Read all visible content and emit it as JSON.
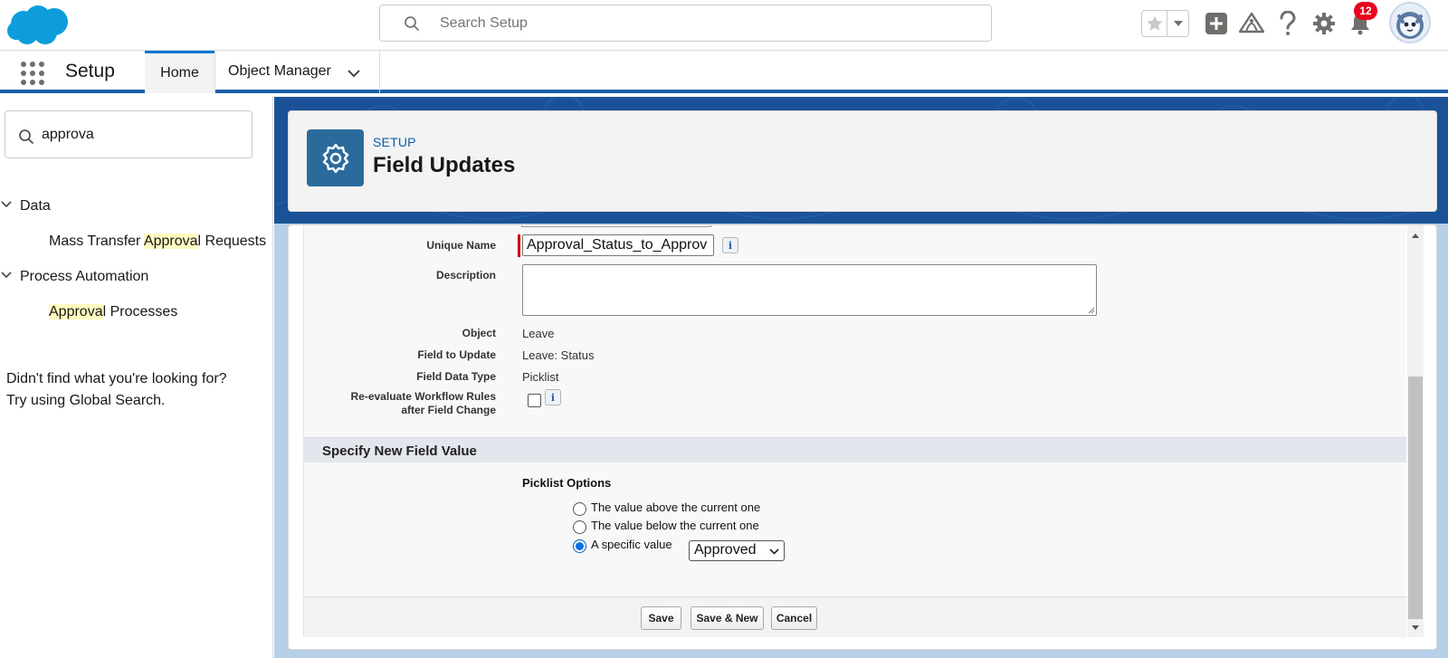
{
  "header": {
    "search_placeholder": "Search Setup",
    "notification_count": "12",
    "icons": [
      "favorites-star-icon",
      "favorites-dropdown-icon",
      "global-actions-plus-icon",
      "trailhead-icon",
      "help-question-icon",
      "setup-gear-icon",
      "notifications-bell-icon",
      "user-avatar"
    ]
  },
  "context_bar": {
    "app_name": "Setup",
    "tabs": [
      {
        "label": "Home",
        "active": true
      },
      {
        "label": "Object Manager",
        "active": false
      }
    ]
  },
  "sidebar": {
    "quick_find_value": "approva",
    "tree": [
      {
        "label": "Data",
        "children": [
          {
            "pre": "Mass Transfer ",
            "hl": "Approva",
            "post": "l Requests"
          }
        ]
      },
      {
        "label": "Process Automation",
        "children": [
          {
            "pre": "",
            "hl": "Approva",
            "post": "l Processes"
          }
        ]
      }
    ],
    "not_found_line1": "Didn't find what you're looking for?",
    "not_found_line2": "Try using Global Search."
  },
  "page_header": {
    "eyebrow": "SETUP",
    "title": "Field Updates"
  },
  "form": {
    "unique_name_label": "Unique Name",
    "unique_name_value": "Approval_Status_to_Approv",
    "description_label": "Description",
    "description_value": "",
    "object_label": "Object",
    "object_value": "Leave",
    "field_to_update_label": "Field to Update",
    "field_to_update_value": "Leave: Status",
    "field_data_type_label": "Field Data Type",
    "field_data_type_value": "Picklist",
    "reevaluate_label_line1": "Re-evaluate Workflow Rules",
    "reevaluate_label_line2": "after Field Change",
    "reevaluate_checked": false,
    "info_glyph": "i",
    "section_title": "Specify New Field Value",
    "picklist_title": "Picklist Options",
    "options": [
      {
        "label": "The value above the current one",
        "checked": false
      },
      {
        "label": "The value below the current one",
        "checked": false
      },
      {
        "label": "A specific value",
        "checked": true
      }
    ],
    "specific_value_selected": "Approved",
    "buttons": {
      "save": "Save",
      "save_new": "Save & New",
      "cancel": "Cancel"
    }
  },
  "colors": {
    "brand_blue": "#0176d3",
    "header_band": "#1b5297",
    "required_red": "#cc0000",
    "badge_red": "#ea001e",
    "highlight_yellow": "#fffac0"
  }
}
